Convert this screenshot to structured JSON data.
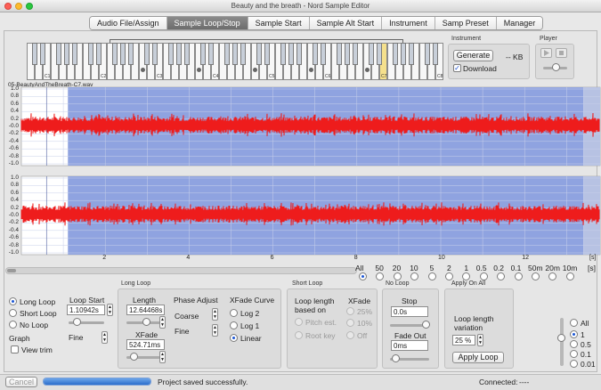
{
  "window": {
    "title": "Beauty and the breath - Nord Sample Editor"
  },
  "tabs": [
    {
      "label": "Audio File/Assign",
      "active": false
    },
    {
      "label": "Sample Loop/Stop",
      "active": true
    },
    {
      "label": "Sample Start",
      "active": false
    },
    {
      "label": "Sample Alt Start",
      "active": false
    },
    {
      "label": "Instrument",
      "active": false
    },
    {
      "label": "Samp Preset",
      "active": false
    },
    {
      "label": "Manager",
      "active": false
    }
  ],
  "keyboard": {
    "octave_labels": [
      "C1",
      "C2",
      "C3",
      "C4",
      "C5",
      "C6",
      "C7",
      "C8"
    ]
  },
  "instrument": {
    "title": "Instrument",
    "generate_label": "Generate",
    "kb_value": "-- KB",
    "download_label": "Download",
    "download_checked": true
  },
  "player": {
    "title": "Player",
    "play_icon": "play-icon",
    "stop_icon": "stop-icon"
  },
  "waveform": {
    "filename": "05-BeautyAndTheBreath-C7.wav",
    "y_ticks": [
      "1.0",
      "0.8",
      "0.6",
      "0.4",
      "0.2",
      "-0.0",
      "-0.2",
      "-0.4",
      "-0.6",
      "-0.8",
      "-1.0"
    ],
    "x_ticks": [
      "2",
      "4",
      "6",
      "8",
      "10",
      "12"
    ],
    "x_unit": "[s]",
    "x_max": 13.8,
    "loop_start_s": 1.10942,
    "loop_end_s": 13.4,
    "wave_color": "#ee1c1c",
    "loop_color": "#8fa3e0"
  },
  "variation": {
    "options": [
      "All",
      "50",
      "20",
      "10",
      "5",
      "2",
      "1",
      "0.5",
      "0.2",
      "0.1",
      "50m",
      "20m",
      "10m"
    ],
    "unit": "[s]",
    "selected": "All"
  },
  "loop_mode": {
    "options": [
      "Long Loop",
      "Short Loop",
      "No Loop"
    ],
    "selected": "Long Loop",
    "graph_label": "Graph",
    "view_trim_label": "View trim",
    "view_trim_checked": false
  },
  "loop_start": {
    "label": "Loop Start",
    "value": "1.10942s",
    "fine_label": "Fine"
  },
  "long_loop": {
    "title": "Long Loop",
    "length_label": "Length",
    "length_value": "12.64468s",
    "xfade_label": "XFade",
    "xfade_value": "524.71ms",
    "phase_label": "Phase Adjust",
    "coarse_label": "Coarse",
    "fine_label": "Fine",
    "curve_label": "XFade Curve",
    "curves": [
      "Log 2",
      "Log 1",
      "Linear"
    ],
    "curve_selected": "Linear"
  },
  "short_loop": {
    "title": "Short Loop",
    "length_label": "Loop length based on",
    "based_on": [
      "Pitch est.",
      "Root key"
    ],
    "xfade_label": "XFade",
    "xfades": [
      "25%",
      "10%",
      "Off"
    ]
  },
  "no_loop": {
    "title": "No Loop",
    "stop_label": "Stop",
    "stop_value": "0.0s",
    "fadeout_label": "Fade Out",
    "fadeout_value": "0ms"
  },
  "apply_on_all": {
    "title": "Apply On All",
    "variation_label": "Loop length variation",
    "variation_value": "25 %",
    "apply_label": "Apply Loop"
  },
  "right_radios": {
    "options": [
      "All",
      "1",
      "0.5",
      "0.1",
      "0.01"
    ],
    "selected": "1"
  },
  "status": {
    "cancel_label": "Cancel",
    "message": "Project saved successfully.",
    "connected_label": "Connected:",
    "connected_value": "----",
    "progress": 1.0
  }
}
